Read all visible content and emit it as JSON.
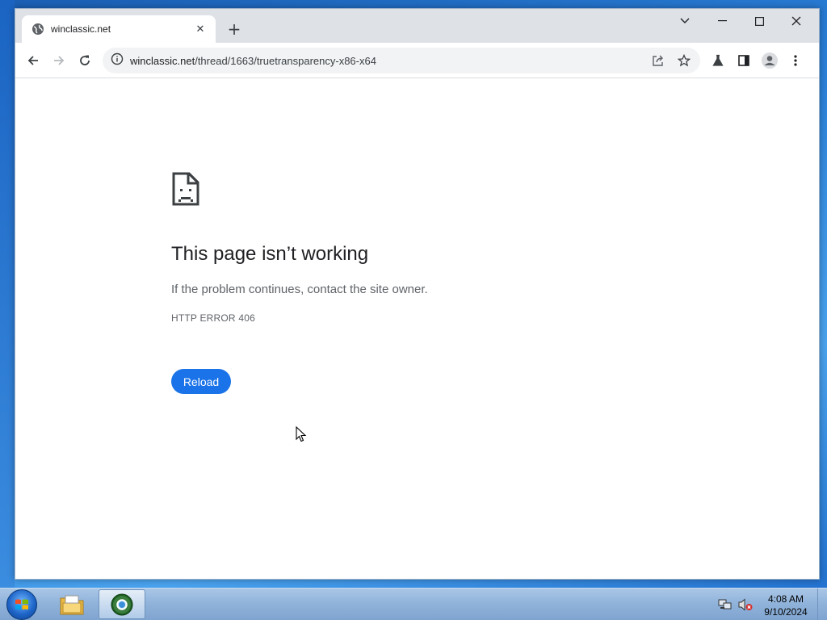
{
  "browser": {
    "tab": {
      "title": "winclassic.net",
      "icon": "globe-icon",
      "close_icon": "close-icon"
    },
    "new_tab_icon": "plus-icon",
    "window_controls": [
      "chevron-down-icon",
      "minimize-icon",
      "maximize-icon",
      "close-icon"
    ],
    "toolbar": {
      "back_icon": "back-arrow-icon",
      "forward_icon": "forward-arrow-icon",
      "reload_icon": "reload-icon",
      "site_info_icon": "info-icon",
      "url_host": "winclassic.net",
      "url_path": "/thread/1663/truetransparency-x86-x64",
      "share_icon": "share-icon",
      "bookmark_icon": "star-icon",
      "labs_icon": "flask-icon",
      "side_panel_icon": "side-panel-icon",
      "profile_icon": "profile-icon",
      "menu_icon": "kebab-menu-icon"
    }
  },
  "error_page": {
    "icon": "sad-page-icon",
    "title": "This page isn’t working",
    "message": "If the problem continues, contact the site owner.",
    "code": "HTTP ERROR 406",
    "reload_label": "Reload"
  },
  "taskbar": {
    "start_icon": "windows-start-icon",
    "pinned": [
      "file-explorer-icon",
      "chrome-browser-icon"
    ],
    "tray": [
      "network-icon",
      "volume-muted-icon"
    ],
    "clock": {
      "time": "4:08 AM",
      "date": "9/10/2024"
    }
  },
  "colors": {
    "accent": "#1a73e8",
    "title_text": "#202124",
    "secondary_text": "#5f6368"
  }
}
